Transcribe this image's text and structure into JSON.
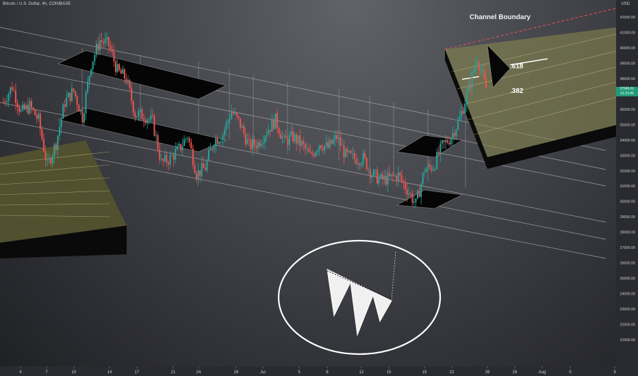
{
  "header": {
    "symbol": "Bitcoin / U.S. Dollar, 4h, COINBASE",
    "currency": "USD"
  },
  "annotations": {
    "channel_boundary": "Channel Boundary",
    "fib_618": ".618",
    "fib_382": ".382"
  },
  "price_tag": {
    "price": "37345.61",
    "countdown": "01:23:45"
  },
  "colors": {
    "up": "#26a69a",
    "down": "#ef5350",
    "fib_fill": "#8c8a4e",
    "boundary": "#ef5350"
  },
  "chart_data": {
    "type": "candlestick",
    "y_axis": {
      "min": 20500,
      "max": 42500,
      "ticks": [
        21000,
        22000,
        23000,
        24000,
        25000,
        26000,
        27000,
        28000,
        29000,
        30000,
        31000,
        32000,
        33000,
        34000,
        35000,
        36000,
        37000,
        38000,
        39000,
        40000,
        41000,
        42000
      ]
    },
    "x_axis": {
      "ticks": [
        "4",
        "7",
        "10",
        "14",
        "17",
        "21",
        "24",
        "28",
        "Jul",
        "5",
        "8",
        "12",
        "15",
        "19",
        "22",
        "26",
        "29",
        "Aug",
        "5",
        "9"
      ]
    },
    "close_path": [
      {
        "x": "Jun 3",
        "close": 36500
      },
      {
        "x": "Jun 4",
        "close": 37500
      },
      {
        "x": "Jun 5",
        "close": 35800
      },
      {
        "x": "Jun 6",
        "close": 36200
      },
      {
        "x": "Jun 7",
        "close": 35300
      },
      {
        "x": "Jun 8",
        "close": 32300
      },
      {
        "x": "Jun 9",
        "close": 33800
      },
      {
        "x": "Jun 10",
        "close": 36500
      },
      {
        "x": "Jun 11",
        "close": 37200
      },
      {
        "x": "Jun 12",
        "close": 35500
      },
      {
        "x": "Jun 13",
        "close": 39000
      },
      {
        "x": "Jun 14",
        "close": 40500
      },
      {
        "x": "Jun 15",
        "close": 40200
      },
      {
        "x": "Jun 16",
        "close": 38500
      },
      {
        "x": "Jun 17",
        "close": 38000
      },
      {
        "x": "Jun 18",
        "close": 35700
      },
      {
        "x": "Jun 19",
        "close": 35600
      },
      {
        "x": "Jun 20",
        "close": 35200
      },
      {
        "x": "Jun 21",
        "close": 32500
      },
      {
        "x": "Jun 22",
        "close": 32800
      },
      {
        "x": "Jun 23",
        "close": 33400
      },
      {
        "x": "Jun 24",
        "close": 34300
      },
      {
        "x": "Jun 25",
        "close": 31800
      },
      {
        "x": "Jun 26",
        "close": 32200
      },
      {
        "x": "Jun 27",
        "close": 34000
      },
      {
        "x": "Jun 28",
        "close": 34400
      },
      {
        "x": "Jun 29",
        "close": 35900
      },
      {
        "x": "Jun 30",
        "close": 35000
      },
      {
        "x": "Jul 1",
        "close": 33600
      },
      {
        "x": "Jul 2",
        "close": 33800
      },
      {
        "x": "Jul 3",
        "close": 34600
      },
      {
        "x": "Jul 4",
        "close": 35300
      },
      {
        "x": "Jul 5",
        "close": 33900
      },
      {
        "x": "Jul 6",
        "close": 34200
      },
      {
        "x": "Jul 7",
        "close": 33700
      },
      {
        "x": "Jul 8",
        "close": 32900
      },
      {
        "x": "Jul 9",
        "close": 33800
      },
      {
        "x": "Jul 10",
        "close": 33500
      },
      {
        "x": "Jul 11",
        "close": 34200
      },
      {
        "x": "Jul 12",
        "close": 33000
      },
      {
        "x": "Jul 13",
        "close": 32800
      },
      {
        "x": "Jul 14",
        "close": 32800
      },
      {
        "x": "Jul 15",
        "close": 31800
      },
      {
        "x": "Jul 16",
        "close": 31400
      },
      {
        "x": "Jul 17",
        "close": 31500
      },
      {
        "x": "Jul 18",
        "close": 31700
      },
      {
        "x": "Jul 19",
        "close": 30800
      },
      {
        "x": "Jul 20",
        "close": 29800
      },
      {
        "x": "Jul 21",
        "close": 32100
      },
      {
        "x": "Jul 22",
        "close": 32300
      },
      {
        "x": "Jul 23",
        "close": 33600
      },
      {
        "x": "Jul 24",
        "close": 34200
      },
      {
        "x": "Jul 25",
        "close": 35400
      },
      {
        "x": "Jul 26",
        "close": 37300
      },
      {
        "x": "Jul 27",
        "close": 39400
      },
      {
        "x": "Jul 28",
        "close": 37345
      }
    ]
  }
}
